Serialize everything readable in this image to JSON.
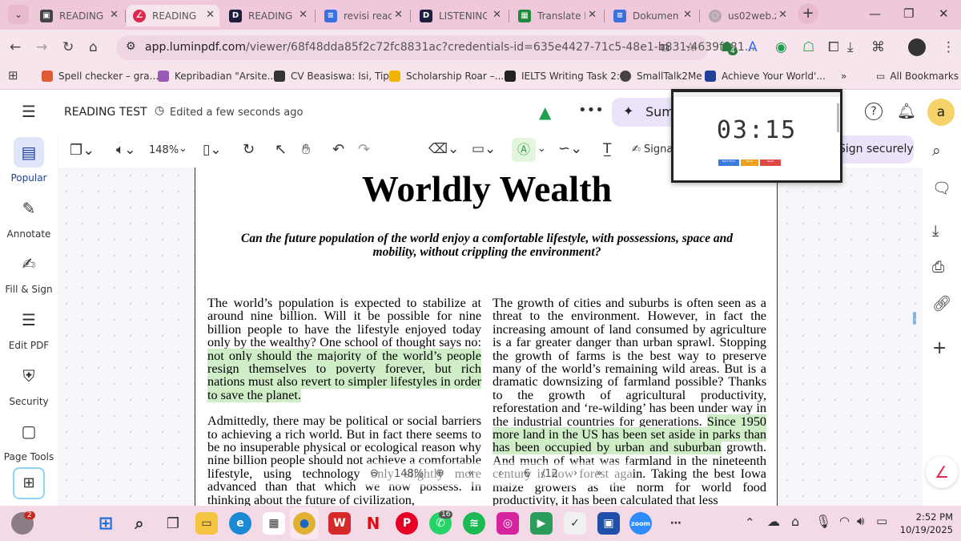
{
  "tabs": [
    {
      "title": "READING",
      "fav_color": "#444",
      "fav": "",
      "active": false
    },
    {
      "title": "READING",
      "fav_color": "#e0284f",
      "fav": "∠",
      "active": true
    },
    {
      "title": "READING",
      "fav_color": "#1e1e3f",
      "fav": "D",
      "active": false
    },
    {
      "title": "revisi read",
      "fav_color": "#3a6fe0",
      "fav": "≡",
      "active": false
    },
    {
      "title": "LISTENING",
      "fav_color": "#1e1e3f",
      "fav": "D",
      "active": false
    },
    {
      "title": "Translate E",
      "fav_color": "#1f8a3a",
      "fav": "▦",
      "active": false
    },
    {
      "title": "Dokumen",
      "fav_color": "#3a6fe0",
      "fav": "≡",
      "active": false
    },
    {
      "title": "us02web.z",
      "fav_color": "#b7a8b0",
      "fav": "◌",
      "active": false
    }
  ],
  "address": {
    "host": "app.luminpdf.com",
    "path": "/viewer/68f48dda85f2c72fc8831ac?credentials-id=635e4427-71c5-48e1-b831-4639f681..."
  },
  "extension_badge": "4",
  "bookmarks": [
    {
      "label": "Spell checker – gra...",
      "color": "#e05a33"
    },
    {
      "label": "Kepribadian \"Arsite...",
      "color": "#9b59b6"
    },
    {
      "label": "CV Beasiswa: Isi, Tip...",
      "color": "#333"
    },
    {
      "label": "Scholarship Roar –...",
      "color": "#f0b400"
    },
    {
      "label": "IELTS Writing Task 2:...",
      "color": "#222"
    },
    {
      "label": "SmallTalk2Me",
      "color": "#444"
    },
    {
      "label": "Achieve Your World'...",
      "color": "#1f3f99"
    }
  ],
  "all_bookmarks": "All Bookmarks",
  "app": {
    "doc_name": "READING TEST",
    "edit_status": "Edited a few seconds ago",
    "summarize_label": "Sum",
    "sign_securely": "Sign securely",
    "avatar": "a",
    "zoom": "148%",
    "sign_label": "Signa"
  },
  "left_rail": [
    {
      "label": "Popular",
      "icon": "▤"
    },
    {
      "label": "Annotate",
      "icon": "✎"
    },
    {
      "label": "Fill & Sign",
      "icon": "✍"
    },
    {
      "label": "Edit PDF",
      "icon": "✎"
    },
    {
      "label": "Security",
      "icon": "⛨"
    },
    {
      "label": "Page Tools",
      "icon": "▢"
    }
  ],
  "document": {
    "title": "Worldly Wealth",
    "subtitle": "Can the future population of the world enjoy a comfortable lifestyle, with possessions, space and mobility, without crippling the environment?",
    "left_p1_a": "The world’s population is expected to stabilize at around nine billion. Will it be possible for nine billion people to have the lifestyle enjoyed today only by the wealthy? One school of thought says no: ",
    "left_p1_hl": "not only should the majority of the world’s people resign themselves to poverty forever, but rich nations must also revert to simpler lifestyles in order to save the planet.",
    "left_p2": "Admittedly, there may be political or social barriers to achieving a rich world. But in fact there seems to be no insuperable physical or ecological reason why nine billion people should not achieve a comfortable lifestyle, using technology only slightly more advanced than that which we now possess. In thinking about the future of civilization,",
    "right_a": "The growth of cities and suburbs is often seen as a threat to the environment. However, in fact the increasing amount of land consumed by agriculture is a far greater danger than urban sprawl. Stopping the growth of farms is the best way to preserve many of the world’s remaining wild areas. But is a dramatic downsizing of farmland possible? Thanks to the growth of agricultural productivity, reforestation and ‘re-wilding’ has been under way in the industrial countries for generations. ",
    "right_hl": "Since 1950 more land in the US has been set aside in parks than has been occupied by urban and suburban",
    "right_b": " growth. And much of what was farmland in the nineteenth century is now forest again. Taking the best Iowa maize growers as the norm for world food productivity, it has been calculated that less"
  },
  "pager": {
    "zoom": "148%",
    "page": "6",
    "total": "/12"
  },
  "timer": {
    "time": "03:15",
    "buttons": [
      "Start Timer",
      "Pause",
      "Reset"
    ]
  },
  "taskbar": {
    "notif_badge": "2",
    "whatsapp_badge": "16",
    "time": "2:52 PM",
    "date": "10/19/2025"
  }
}
